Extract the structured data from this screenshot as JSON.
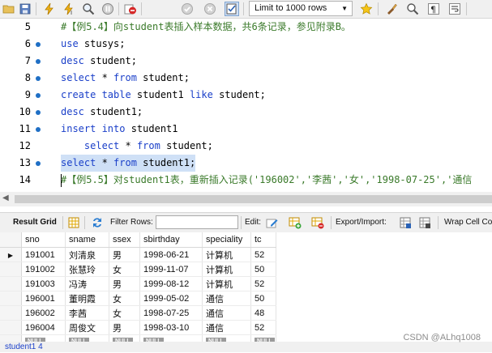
{
  "toolbar": {
    "limit_value": "Limit to 1000 rows"
  },
  "editor": {
    "lines": [
      {
        "num": "5",
        "dot": false,
        "parts": [
          [
            "cm",
            "#【例5.4】向student表插入样本数据，共6条记录，参见附录B。"
          ]
        ]
      },
      {
        "num": "6",
        "dot": true,
        "parts": [
          [
            "kw",
            "use"
          ],
          [
            "",
            " stusys;"
          ]
        ]
      },
      {
        "num": "7",
        "dot": true,
        "parts": [
          [
            "kw",
            "desc"
          ],
          [
            "",
            " student;"
          ]
        ]
      },
      {
        "num": "8",
        "dot": true,
        "parts": [
          [
            "kw",
            "select"
          ],
          [
            "",
            " * "
          ],
          [
            "kw",
            "from"
          ],
          [
            "",
            " student;"
          ]
        ]
      },
      {
        "num": "9",
        "dot": true,
        "parts": [
          [
            "kw",
            "create table"
          ],
          [
            "",
            " student1 "
          ],
          [
            "kw",
            "like"
          ],
          [
            "",
            " student;"
          ]
        ]
      },
      {
        "num": "10",
        "dot": true,
        "parts": [
          [
            "kw",
            "desc"
          ],
          [
            "",
            " student1;"
          ]
        ]
      },
      {
        "num": "11",
        "dot": true,
        "parts": [
          [
            "kw",
            "insert into"
          ],
          [
            "",
            " student1"
          ]
        ]
      },
      {
        "num": "12",
        "dot": false,
        "parts": [
          [
            "",
            "    "
          ],
          [
            "kw",
            "select"
          ],
          [
            "",
            " * "
          ],
          [
            "kw",
            "from"
          ],
          [
            "",
            " student;"
          ]
        ]
      },
      {
        "num": "13",
        "dot": true,
        "selected": true,
        "parts": [
          [
            "kw",
            "select"
          ],
          [
            "",
            " * "
          ],
          [
            "kw",
            "from"
          ],
          [
            "",
            " student1;"
          ]
        ]
      },
      {
        "num": "14",
        "dot": false,
        "parts": [
          [
            "cm",
            "#【例5.5】对student1表，重新插入记录('196002','李茜','女','1998-07-25','通信"
          ]
        ]
      }
    ]
  },
  "result_toolbar": {
    "result_grid": "Result Grid",
    "filter_rows": "Filter Rows:",
    "edit": "Edit:",
    "export_import": "Export/Import:",
    "wrap": "Wrap Cell Co"
  },
  "grid": {
    "columns": [
      "sno",
      "sname",
      "ssex",
      "sbirthday",
      "speciality",
      "tc"
    ],
    "rows": [
      [
        "191001",
        "刘清泉",
        "男",
        "1998-06-21",
        "计算机",
        "52"
      ],
      [
        "191002",
        "张慧玲",
        "女",
        "1999-11-07",
        "计算机",
        "50"
      ],
      [
        "191003",
        "冯涛",
        "男",
        "1999-08-12",
        "计算机",
        "52"
      ],
      [
        "196001",
        "董明霞",
        "女",
        "1999-05-02",
        "通信",
        "50"
      ],
      [
        "196002",
        "李茜",
        "女",
        "1998-07-25",
        "通信",
        "48"
      ],
      [
        "196004",
        "周俊文",
        "男",
        "1998-03-10",
        "通信",
        "52"
      ]
    ],
    "null_label": "NULL"
  },
  "bottom_tab": "student1 4",
  "watermark": "CSDN @ALhq1008"
}
